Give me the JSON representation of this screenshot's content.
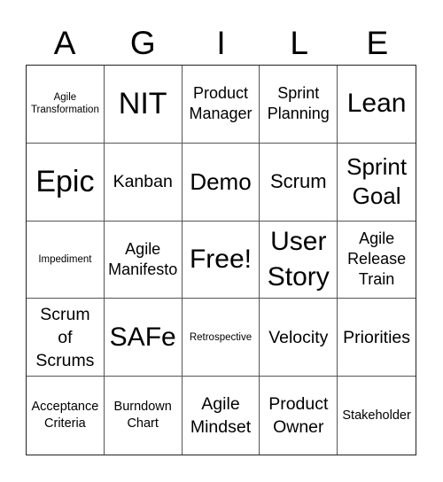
{
  "header": {
    "letters": [
      "A",
      "G",
      "I",
      "L",
      "E"
    ]
  },
  "cells": [
    [
      {
        "text": "Agile Transformation",
        "size": "xs"
      },
      {
        "text": "NIT",
        "size": "xxl"
      },
      {
        "text": "Product Manager",
        "size": "m"
      },
      {
        "text": "Sprint Planning",
        "size": "m"
      },
      {
        "text": "Lean",
        "size": "xl"
      }
    ],
    [
      {
        "text": "Epic",
        "size": "xxl"
      },
      {
        "text": "Kanban",
        "size": "m2"
      },
      {
        "text": "Demo",
        "size": "l2"
      },
      {
        "text": "Scrum",
        "size": "l"
      },
      {
        "text": "Sprint Goal",
        "size": "l2"
      }
    ],
    [
      {
        "text": "Impediment",
        "size": "xs"
      },
      {
        "text": "Agile Manifesto",
        "size": "m"
      },
      {
        "text": "Free!",
        "size": "xl"
      },
      {
        "text": "User Story",
        "size": "xl"
      },
      {
        "text": "Agile Release Train",
        "size": "m"
      }
    ],
    [
      {
        "text": "Scrum of Scrums",
        "size": "m2"
      },
      {
        "text": "SAFe",
        "size": "xl"
      },
      {
        "text": "Retrospective",
        "size": "xs"
      },
      {
        "text": "Velocity",
        "size": "m2"
      },
      {
        "text": "Priorities",
        "size": "m2"
      }
    ],
    [
      {
        "text": "Acceptance Criteria",
        "size": "s"
      },
      {
        "text": "Burndown Chart",
        "size": "s"
      },
      {
        "text": "Agile Mindset",
        "size": "m2"
      },
      {
        "text": "Product Owner",
        "size": "m2"
      },
      {
        "text": "Stakeholder",
        "size": "s"
      }
    ]
  ]
}
